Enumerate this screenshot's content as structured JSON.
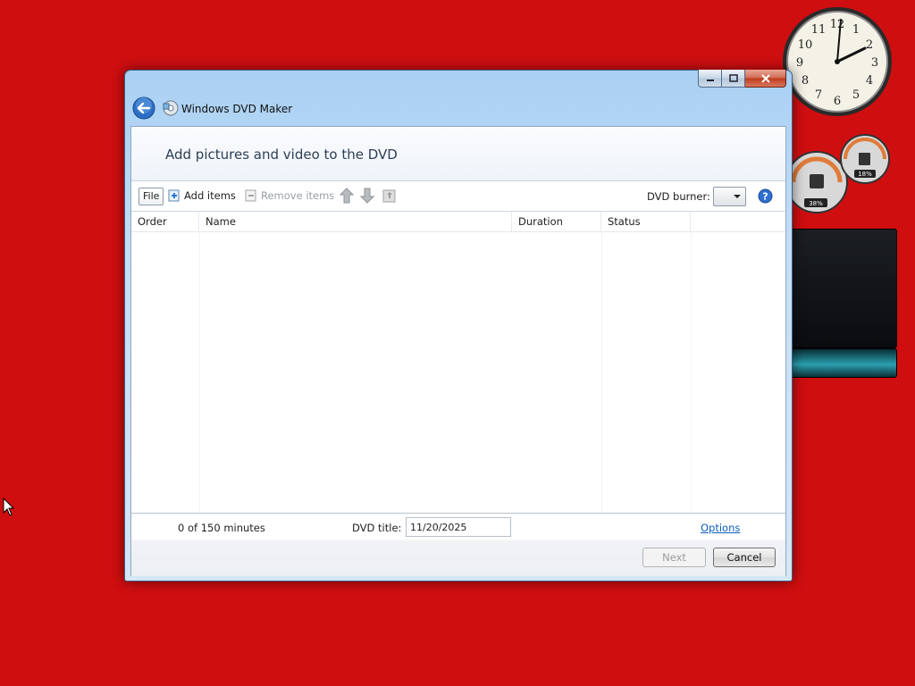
{
  "window": {
    "title": "Windows DVD Maker",
    "header": "Add pictures and video to the DVD"
  },
  "toolbar": {
    "file_label": "File",
    "add_label": "Add items",
    "remove_label": "Remove items",
    "burner_label": "DVD burner:",
    "burner_value": ""
  },
  "table": {
    "columns": [
      "Order",
      "Name",
      "Duration",
      "Status"
    ],
    "rows": []
  },
  "footer": {
    "minutes": "0 of 150 minutes",
    "dvd_title_label": "DVD title:",
    "dvd_title_value": "11/20/2025",
    "options_label": "Options",
    "next_label": "Next",
    "cancel_label": "Cancel"
  },
  "gadgets": {
    "cpu_percent": "38%",
    "memory_percent": "18%"
  },
  "colors": {
    "desktop": "#cf0e10",
    "link": "#0b5fbf",
    "title_bar": "#a9d0f3"
  },
  "icons": {
    "back": "back-arrow-icon",
    "app": "dvd-maker-icon",
    "add": "add-items-icon",
    "remove": "remove-items-icon",
    "up": "move-up-icon",
    "down": "move-down-icon",
    "open": "open-folder-icon",
    "help": "help-icon"
  }
}
